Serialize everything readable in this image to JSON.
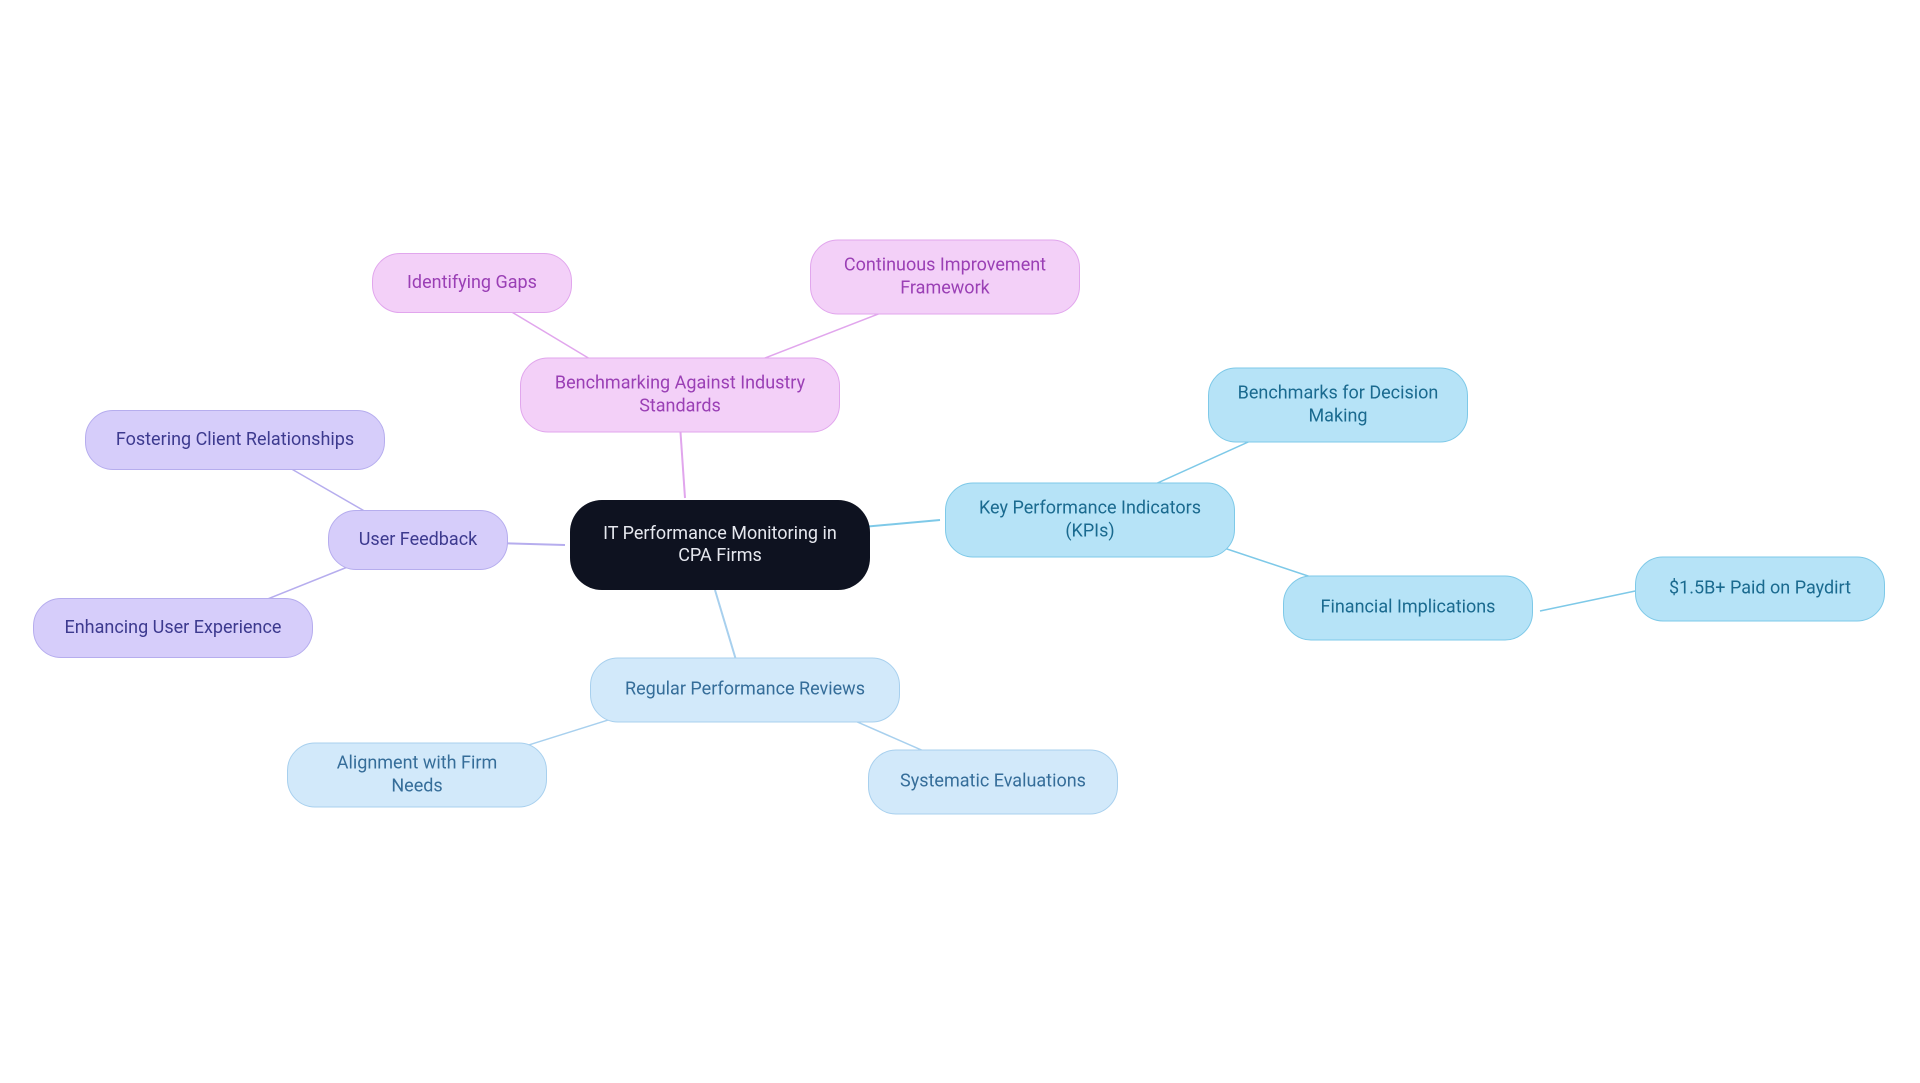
{
  "center": {
    "label": "IT Performance Monitoring in CPA Firms"
  },
  "kpi": {
    "label": "Key Performance Indicators (KPIs)",
    "benchmarks": "Benchmarks for Decision Making",
    "financial": "Financial Implications",
    "paydirt": "$1.5B+ Paid on Paydirt"
  },
  "reviews": {
    "label": "Regular Performance Reviews",
    "systematic": "Systematic Evaluations",
    "alignment": "Alignment with Firm Needs"
  },
  "feedback": {
    "label": "User Feedback",
    "fostering": "Fostering Client Relationships",
    "enhancing": "Enhancing User Experience"
  },
  "benchmarking": {
    "label": "Benchmarking Against Industry Standards",
    "gaps": "Identifying Gaps",
    "framework": "Continuous Improvement Framework"
  }
}
